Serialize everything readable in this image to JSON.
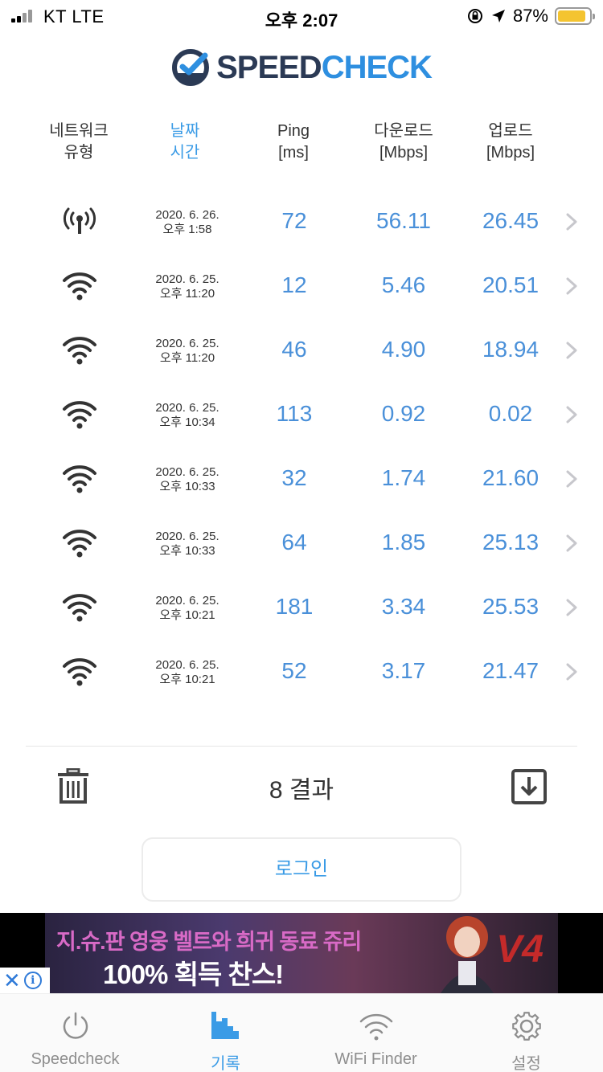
{
  "status_bar": {
    "carrier": "KT   LTE",
    "time": "오후 2:07",
    "battery": "87%",
    "battery_level": 0.87
  },
  "logo": {
    "part1": "SPEED",
    "part2": "CHECK"
  },
  "table": {
    "headers": {
      "network": [
        "네트워크",
        "유형"
      ],
      "date": [
        "날짜",
        "시간"
      ],
      "ping": [
        "Ping",
        "[ms]"
      ],
      "download": [
        "다운로드",
        "[Mbps]"
      ],
      "upload": [
        "업로드",
        "[Mbps]"
      ]
    },
    "rows": [
      {
        "type": "cellular-icon",
        "date": "2020. 6. 26.",
        "time": "오후 1:58",
        "ping": "72",
        "download": "56.11",
        "upload": "26.45"
      },
      {
        "type": "wifi-icon",
        "date": "2020. 6. 25.",
        "time": "오후 11:20",
        "ping": "12",
        "download": "5.46",
        "upload": "20.51"
      },
      {
        "type": "wifi-icon",
        "date": "2020. 6. 25.",
        "time": "오후 11:20",
        "ping": "46",
        "download": "4.90",
        "upload": "18.94"
      },
      {
        "type": "wifi-icon",
        "date": "2020. 6. 25.",
        "time": "오후 10:34",
        "ping": "113",
        "download": "0.92",
        "upload": "0.02"
      },
      {
        "type": "wifi-icon",
        "date": "2020. 6. 25.",
        "time": "오후 10:33",
        "ping": "32",
        "download": "1.74",
        "upload": "21.60"
      },
      {
        "type": "wifi-icon",
        "date": "2020. 6. 25.",
        "time": "오후 10:33",
        "ping": "64",
        "download": "1.85",
        "upload": "25.13"
      },
      {
        "type": "wifi-icon",
        "date": "2020. 6. 25.",
        "time": "오후 10:21",
        "ping": "181",
        "download": "3.34",
        "upload": "25.53"
      },
      {
        "type": "wifi-icon",
        "date": "2020. 6. 25.",
        "time": "오후 10:21",
        "ping": "52",
        "download": "3.17",
        "upload": "21.47"
      }
    ]
  },
  "results_label": "8 결과",
  "login_label": "로그인",
  "ad": {
    "line1": "지.슈.판 영웅 벨트와 희귀 동료 쥬리",
    "line2": "100% 획득 찬스!",
    "brand": "V4"
  },
  "tabs": [
    {
      "label": "Speedcheck",
      "icon": "power-icon"
    },
    {
      "label": "기록",
      "icon": "history-chart-icon",
      "active": true
    },
    {
      "label": "WiFi Finder",
      "icon": "wifi-icon"
    },
    {
      "label": "설정",
      "icon": "gear-icon"
    }
  ],
  "colors": {
    "accent": "#3a9be6",
    "value": "#4a90d9",
    "brand_dark": "#2b3a55",
    "battery": "#f4c430"
  }
}
